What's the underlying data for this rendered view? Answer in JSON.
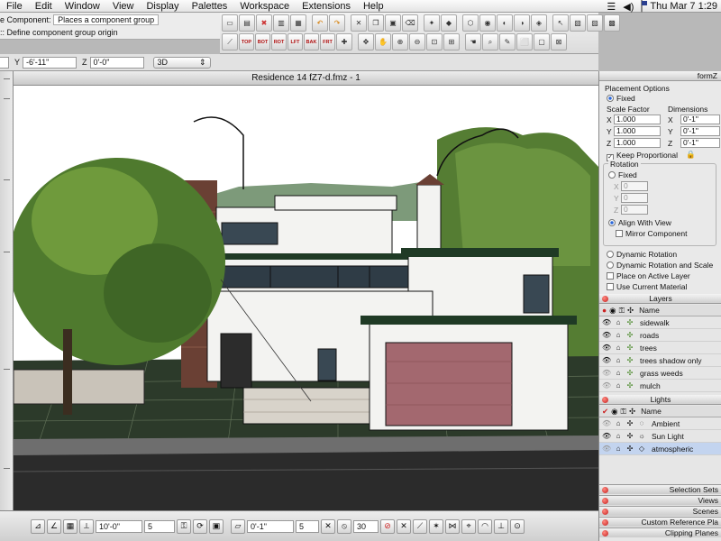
{
  "menubar": {
    "items": [
      "File",
      "Edit",
      "Window",
      "View",
      "Display",
      "Palettes",
      "Workspace",
      "Extensions",
      "Help"
    ],
    "clock": "Thu Mar 7  1:29"
  },
  "info": {
    "line1_label": "e Component:",
    "line1_value": "Places a component group",
    "line2": ":: Define component group origin"
  },
  "toolbar": {
    "view_buttons": [
      "TOP",
      "BOT",
      "ROT",
      "LFT",
      "BAK",
      "FRT"
    ]
  },
  "coords": {
    "y_label": "Y",
    "y_value": "-6'-11\"",
    "z_label": "Z",
    "z_value": "0'-0\"",
    "mode": "3D"
  },
  "document": {
    "title": "Residence 14 fZ7-d.fmz - 1"
  },
  "palette": {
    "title": "formZ",
    "placement_options": "Placement Options",
    "fixed": "Fixed",
    "scale_factor": "Scale Factor",
    "dimensions": "Dimensions",
    "scale": {
      "x": "1.000",
      "y": "1.000",
      "z": "1.000"
    },
    "dims": {
      "x": "0'-1\"",
      "y": "0'-1\"",
      "z": "0'-1\""
    },
    "keep_proportional": "Keep Proportional",
    "rotation": "Rotation",
    "rotation_fixed": "Fixed",
    "rotation_values": {
      "x": "0",
      "y": "0",
      "z": "0"
    },
    "align_with_view": "Align With View",
    "mirror_component": "Mirror Component",
    "dynamic_rotation": "Dynamic Rotation",
    "dynamic_rotation_scale": "Dynamic Rotation and Scale",
    "place_on_active_layer": "Place on Active Layer",
    "use_current_material": "Use Current Material",
    "layers_title": "Layers",
    "layers_name_col": "Name",
    "layers": [
      "sidewalk",
      "roads",
      "trees",
      "trees shadow only",
      "grass weeds",
      "mulch"
    ],
    "lights_title": "Lights",
    "lights_name_col": "Name",
    "lights": [
      "Ambient",
      "Sun Light",
      "atmospheric"
    ],
    "footers": [
      "Selection Sets",
      "Views",
      "Scenes",
      "Custom Reference Pla",
      "Clipping Planes"
    ]
  },
  "bottom": {
    "field1": "10'-0\"",
    "field2": "5",
    "field3": "0'-1\"",
    "field4": "5",
    "field5": "30"
  },
  "colors": {
    "sky": "#ffffff",
    "foliage": "#4f7a2e",
    "stucco": "#f3f3f1",
    "garage": "#a3686f",
    "roof": "#223d28",
    "road": "#2b2b2b",
    "highlight": "#c3d4ef"
  }
}
